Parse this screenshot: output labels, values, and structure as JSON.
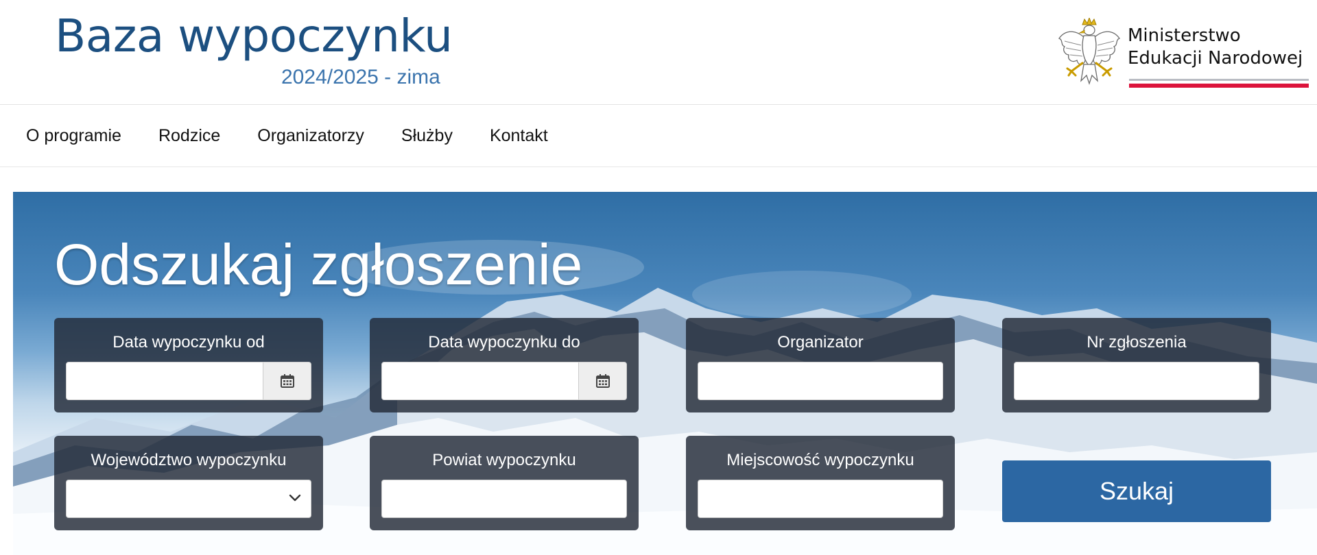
{
  "header": {
    "site_title": "Baza wypoczynku",
    "site_subtitle": "2024/2025 - zima",
    "ministry_line1": "Ministerstwo",
    "ministry_line2": "Edukacji Narodowej",
    "logo_icon": "polish-eagle-emblem"
  },
  "nav": {
    "items": [
      "O programie",
      "Rodzice",
      "Organizatorzy",
      "Służby",
      "Kontakt"
    ]
  },
  "search": {
    "title": "Odszukaj zgłoszenie",
    "fields": {
      "date_from": {
        "label": "Data wypoczynku od",
        "value": "",
        "icon": "calendar-icon"
      },
      "date_to": {
        "label": "Data wypoczynku do",
        "value": "",
        "icon": "calendar-icon"
      },
      "organizer": {
        "label": "Organizator",
        "value": ""
      },
      "application_no": {
        "label": "Nr zgłoszenia",
        "value": ""
      },
      "voivodeship": {
        "label": "Województwo wypoczynku",
        "value": "",
        "icon": "chevron-down-icon"
      },
      "county": {
        "label": "Powiat wypoczynku",
        "value": ""
      },
      "locality": {
        "label": "Miejscowość wypoczynku",
        "value": ""
      }
    },
    "submit_label": "Szukaj"
  },
  "colors": {
    "title_blue": "#1c4f80",
    "subtitle_blue": "#3b74ad",
    "button_blue": "#2c67a3",
    "ministry_red": "#dc143c"
  }
}
